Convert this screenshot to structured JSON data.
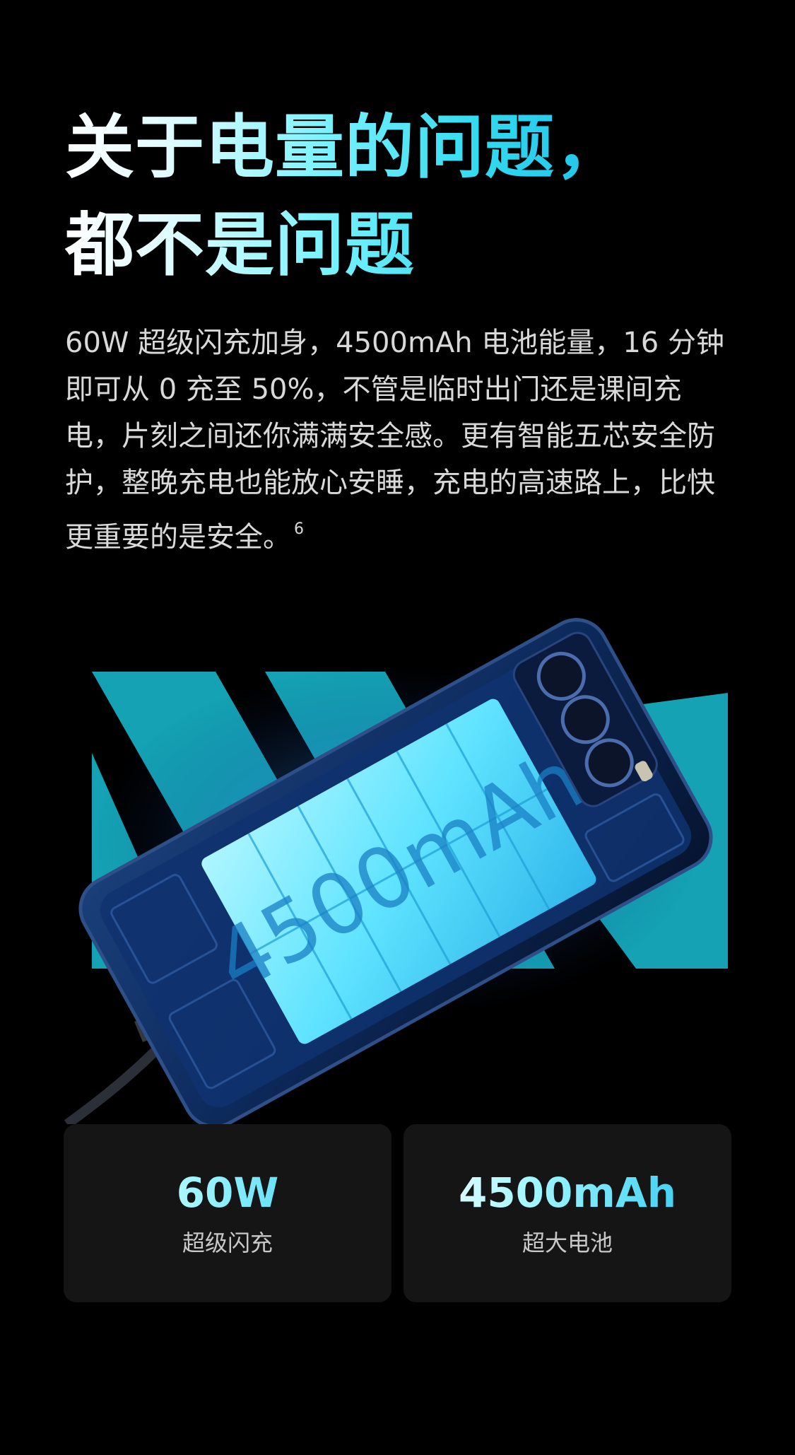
{
  "headline": {
    "line1": "关于电量的问题，",
    "line2": "都不是问题"
  },
  "body": {
    "text": "60W 超级闪充加身，4500mAh 电池能量，16 分钟即可从 0 充至 50%，不管是临时出门还是课间充电，片刻之间还你满满安全感。更有智能五芯安全防护，整晚充电也能放心安睡，充电的高速路上，比快更重要的是安全。",
    "footnote": "6"
  },
  "hero": {
    "battery_label": "4500mAh",
    "accent_color": "#14a2b4",
    "battery_color": "#5fe3ff"
  },
  "stats": [
    {
      "value": "60W",
      "label": "超级闪充"
    },
    {
      "value": "4500mAh",
      "label": "超大电池"
    }
  ],
  "colors": {
    "background": "#000000",
    "card": "#151515",
    "gradient_start": "#ffffff",
    "gradient_end": "#14a7ea"
  }
}
